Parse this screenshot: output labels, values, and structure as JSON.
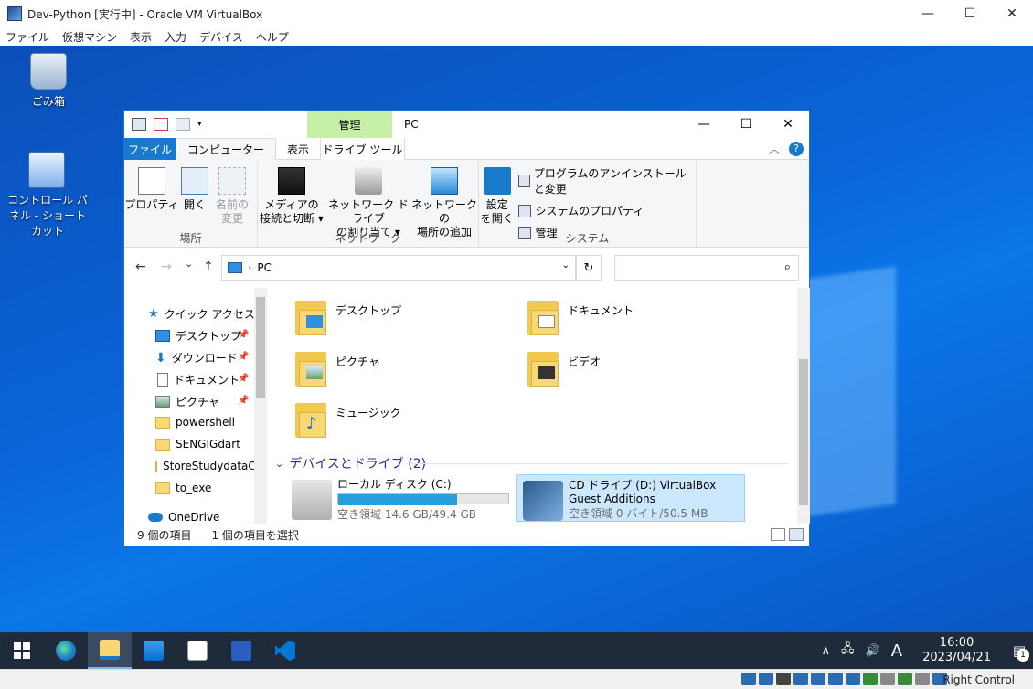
{
  "host": {
    "title": "Dev-Python [実行中] - Oracle VM VirtualBox",
    "menu": [
      "ファイル",
      "仮想マシン",
      "表示",
      "入力",
      "デバイス",
      "ヘルプ"
    ],
    "window_buttons": {
      "minimize": "—",
      "maximize": "☐",
      "close": "✕"
    },
    "host_key": "Right Control",
    "status_icons": [
      "hdd-icon",
      "optical-icon",
      "audio-icon",
      "network-icon",
      "usb-icon",
      "shared-folder-icon",
      "display-icon",
      "video-capture-icon",
      "recording-icon",
      "cpu-icon",
      "mouse-integration-icon",
      "keyboard-icon"
    ]
  },
  "desktop": {
    "icons": [
      {
        "label": "ごみ箱",
        "icon": "recycle-bin-icon"
      },
      {
        "label": "コントロール パネル - ショートカット",
        "icon": "control-panel-icon"
      }
    ]
  },
  "explorer": {
    "title": "PC",
    "contextual_tab_header": "管理",
    "window_buttons": {
      "minimize": "—",
      "maximize": "☐",
      "close": "✕"
    },
    "tabs": [
      "ファイル",
      "コンピューター",
      "表示",
      "ドライブ ツール"
    ],
    "ribbon_collapse": "︿",
    "help": "?",
    "ribbon": {
      "location": {
        "label": "場所",
        "buttons": [
          "プロパティ",
          "開く",
          "名前の\n変更"
        ]
      },
      "network": {
        "label": "ネットワーク",
        "buttons": [
          "メディアの\n接続と切断 ▾",
          "ネットワーク ドライブ\nの割り当て ▾",
          "ネットワークの\n場所の追加"
        ]
      },
      "system": {
        "label": "システム",
        "open_settings": "設定\nを開く",
        "items": [
          "プログラムのアンインストールと変更",
          "システムのプロパティ",
          "管理"
        ]
      }
    },
    "address": {
      "back": "←",
      "forward": "→",
      "recent": "⌄",
      "up": "↑",
      "path": "PC",
      "separator": "›",
      "dropdown": "⌄",
      "refresh": "↻",
      "search_placeholder": "",
      "search_icon": "⌕"
    },
    "nav_pane": {
      "quick_access": "クイック アクセス",
      "pinned": [
        "デスクトップ",
        "ダウンロード",
        "ドキュメント",
        "ピクチャ"
      ],
      "folders": [
        "powershell",
        "SENGIGdart",
        "StoreStudydataC",
        "to_exe"
      ],
      "onedrive": "OneDrive",
      "pin_glyph": "📌"
    },
    "folders": [
      {
        "name": "デスクトップ",
        "kind": "desk"
      },
      {
        "name": "ドキュメント",
        "kind": "doc"
      },
      {
        "name": "ピクチャ",
        "kind": "pic"
      },
      {
        "name": "ビデオ",
        "kind": "vid"
      },
      {
        "name": "ミュージック",
        "kind": "mus"
      }
    ],
    "devices_header": "デバイスとドライブ (2)",
    "devices_chevron": "⌄",
    "drives": [
      {
        "name": "ローカル ディスク (C:)",
        "free": "空き領域 14.6 GB/49.4 GB",
        "used_fraction": 0.7
      },
      {
        "name": "CD ドライブ (D:) VirtualBox Guest Additions",
        "free": "空き領域 0 バイト/50.5 MB",
        "selected": true
      }
    ],
    "status": {
      "items": "9 個の項目",
      "selected": "1 個の項目を選択"
    }
  },
  "taskbar": {
    "apps": [
      "start-button",
      "edge-icon",
      "file-explorer-icon",
      "store-icon",
      "notepad-icon",
      "powershell-icon",
      "vscode-icon"
    ],
    "tray": {
      "chevron": "∧",
      "network": "🖧",
      "volume": "🔊",
      "ime": "A",
      "time": "16:00",
      "date": "2023/04/21",
      "notification_count": "1"
    }
  },
  "colors": {
    "desktop": "#0a66d9",
    "ribbon_file_tab": "#1979ca",
    "manage_tab": "#c6efa8",
    "selection": "#cce8ff",
    "drive_bar": "#26a0da"
  }
}
